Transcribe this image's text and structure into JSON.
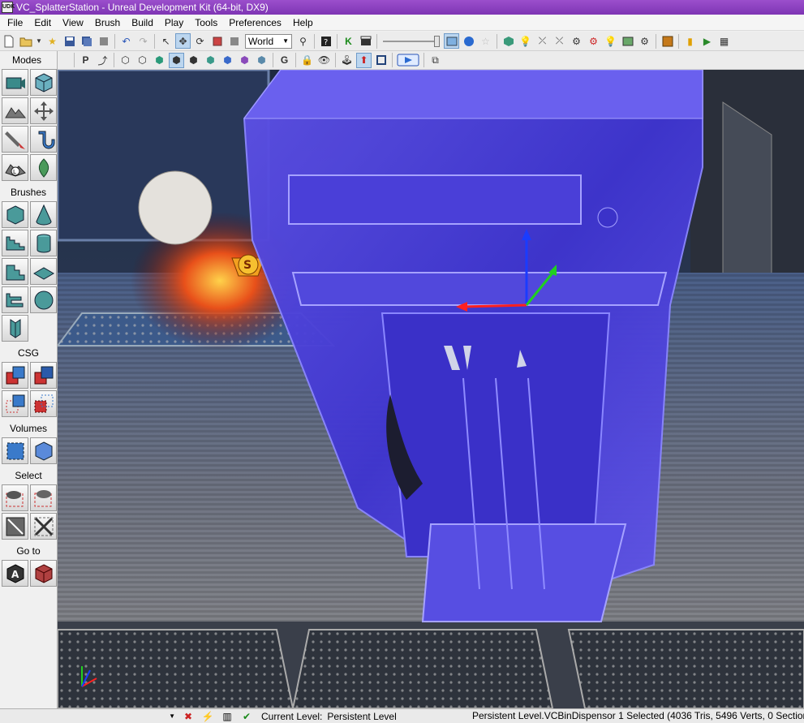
{
  "window": {
    "title": "VC_SplatterStation - Unreal Development Kit (64-bit, DX9)",
    "app_icon_text": "UDK"
  },
  "menu": [
    "File",
    "Edit",
    "View",
    "Brush",
    "Build",
    "Play",
    "Tools",
    "Preferences",
    "Help"
  ],
  "toolbar": {
    "coordinate_system": "World",
    "k_label": "K"
  },
  "modes_toolbar": {
    "p_label": "P",
    "g_label": "G"
  },
  "modes_panel": {
    "sections": [
      {
        "title": "Modes",
        "buttons": [
          "camera-mode",
          "geometry-mode",
          "terrain-mode",
          "texture-alignment-mode",
          "mesh-paint-mode",
          "static-mesh-mode",
          "landscape-mode",
          "foliage-mode"
        ]
      },
      {
        "title": "Brushes",
        "buttons": [
          "cube-brush",
          "cone-brush",
          "curved-staircase-brush",
          "cylinder-brush",
          "linear-staircase-brush",
          "sheet-brush",
          "spiral-staircase-brush",
          "volumetric-brush",
          "tetrahedron-brush"
        ]
      },
      {
        "title": "CSG",
        "buttons": [
          "csg-add",
          "csg-subtract",
          "csg-intersect",
          "csg-deintersect"
        ]
      },
      {
        "title": "Volumes",
        "buttons": [
          "add-volume",
          "volume-list"
        ]
      },
      {
        "title": "Select",
        "buttons": [
          "show-selected",
          "hide-selected",
          "select-all",
          "invert-selection"
        ]
      },
      {
        "title": "Go to",
        "buttons": [
          "goto-actor",
          "goto-builder-brush"
        ]
      }
    ]
  },
  "status_bar": {
    "level_label": "Current Level:",
    "level_value": "Persistent Level",
    "selection_info": "Persistent Level.VCBinDispensor   1 Selected (4036 Tris, 5496 Verts, 0 Sections)"
  },
  "viewport": {
    "pickup_letter": "S"
  }
}
